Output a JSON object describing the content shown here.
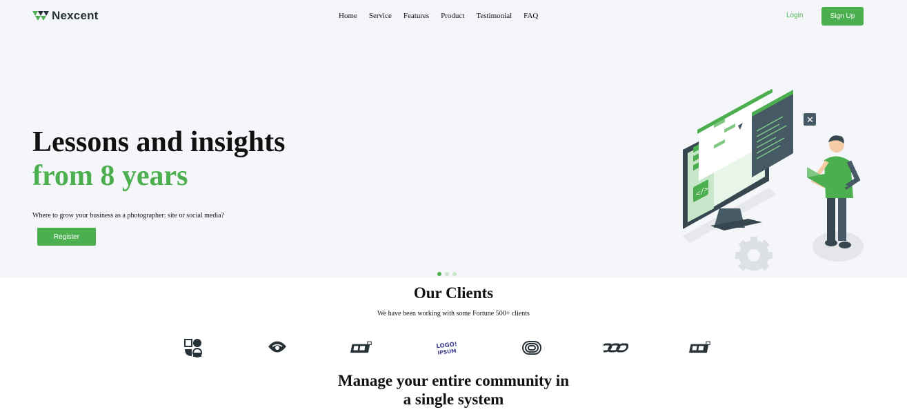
{
  "brand": {
    "name": "Nexcent",
    "accent": "#4caf4f",
    "dark": "#263238",
    "hero_bg": "#f5f6fa"
  },
  "nav": {
    "items": [
      "Home",
      "Service",
      "Features",
      "Product",
      "Testimonial",
      "FAQ"
    ]
  },
  "header": {
    "login_label": "Login",
    "signup_label": "Sign Up"
  },
  "hero": {
    "title_line1": "Lessons and insights",
    "title_line2": "from 8 years",
    "subtitle": "Where to grow your business as a photographer: site or social media?",
    "register_label": "Register",
    "illustration_icon": "developer-at-monitor-illustration"
  },
  "carousel": {
    "slides": 3,
    "active": 1
  },
  "clients": {
    "title": "Our Clients",
    "subtitle": "We have been working with some Fortune 500+ clients",
    "logos": [
      "client-logo-1-icon",
      "client-logo-2-icon",
      "client-logo-3-icon",
      "client-logo-4-icon",
      "client-logo-5-icon",
      "client-logo-6-icon",
      "client-logo-7-icon"
    ],
    "logo4_text_top": "LOGO!",
    "logo4_text_bottom": "IPSUM"
  },
  "community": {
    "title_line1": "Manage your entire community in",
    "title_line2": "a single system"
  }
}
